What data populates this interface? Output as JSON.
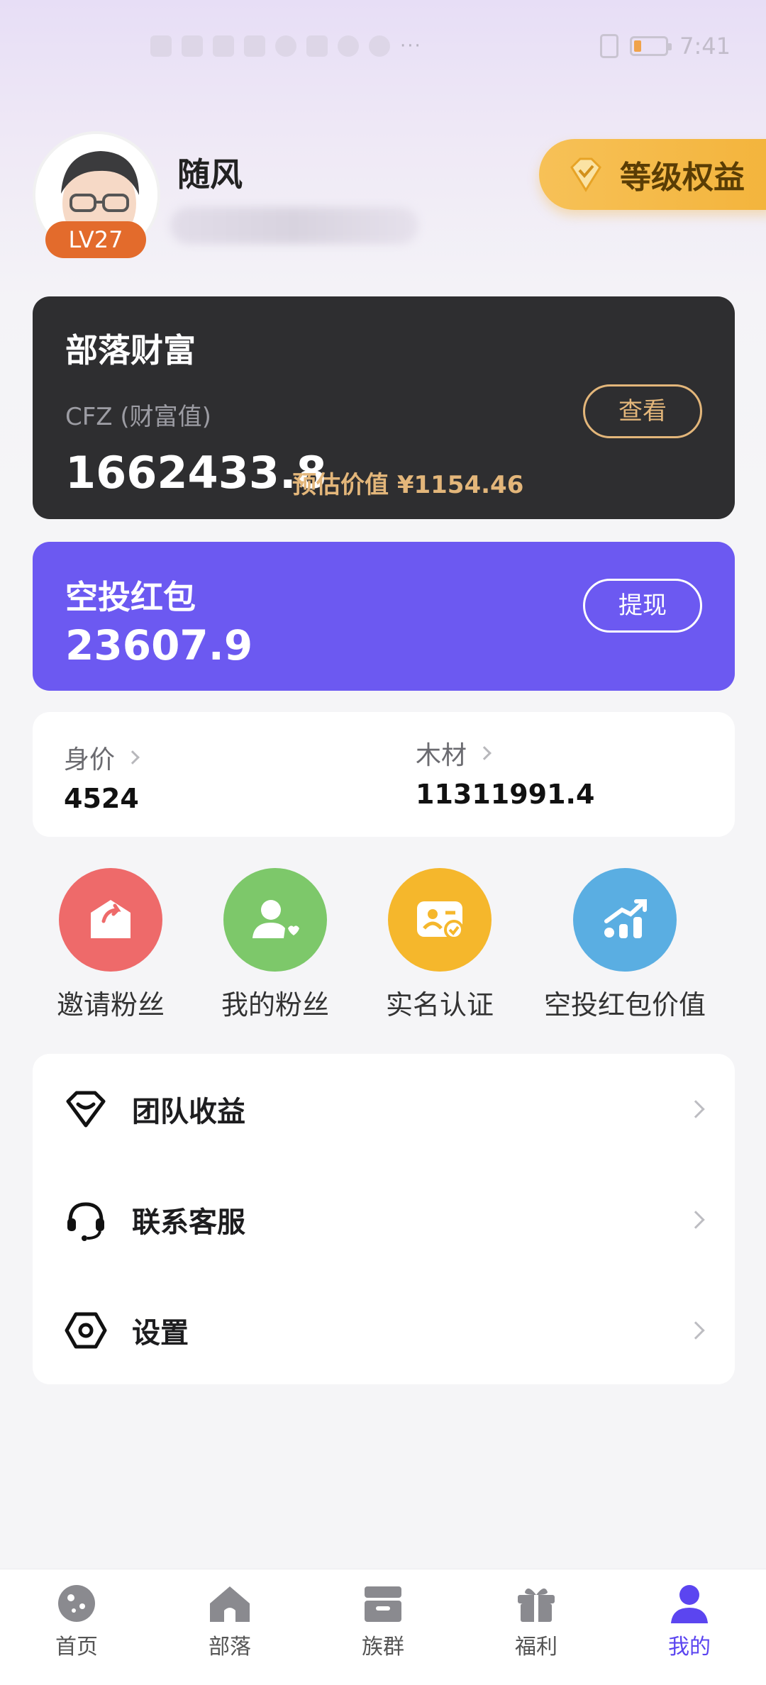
{
  "status_bar": {
    "left_icons": [
      "hd-icon",
      "5g-icon",
      "signal-icon",
      "wifi-icon",
      "mail-icon",
      "app-icon",
      "app-icon",
      "app-icon",
      "weibo-icon"
    ],
    "overflow": "···",
    "time": "7:41"
  },
  "profile": {
    "name": "随风",
    "level_badge": "LV27",
    "level_button_label": "等级权益"
  },
  "wealth": {
    "title": "部落财富",
    "subtitle": "CFZ (财富值)",
    "value": "1662433.8",
    "estimated": "预估价值 ¥1154.46",
    "view_button": "查看",
    "accent_color": "#e3b67a"
  },
  "airdrop": {
    "title": "空投红包",
    "value": "23607.9",
    "withdraw_button": "提现",
    "bg_color": "#6c59f1"
  },
  "stats": [
    {
      "label": "身价",
      "value": "4524"
    },
    {
      "label": "木材",
      "value": "11311991.4"
    }
  ],
  "quick_actions": [
    {
      "label": "邀请粉丝",
      "icon": "invite-icon",
      "color": "#ee6a6a"
    },
    {
      "label": "我的粉丝",
      "icon": "fans-icon",
      "color": "#7dc86a"
    },
    {
      "label": "实名认证",
      "icon": "id-card-icon",
      "color": "#f5b72c"
    },
    {
      "label": "空投红包价值",
      "icon": "chart-up-icon",
      "color": "#5aaee2"
    }
  ],
  "menu": [
    {
      "label": "团队收益",
      "icon": "team-income-icon"
    },
    {
      "label": "联系客服",
      "icon": "headset-icon"
    },
    {
      "label": "设置",
      "icon": "settings-icon"
    }
  ],
  "tabbar": [
    {
      "label": "首页",
      "icon": "home-planet-icon"
    },
    {
      "label": "部落",
      "icon": "house-icon"
    },
    {
      "label": "族群",
      "icon": "store-icon"
    },
    {
      "label": "福利",
      "icon": "gift-icon"
    },
    {
      "label": "我的",
      "icon": "user-icon",
      "active": true
    }
  ]
}
